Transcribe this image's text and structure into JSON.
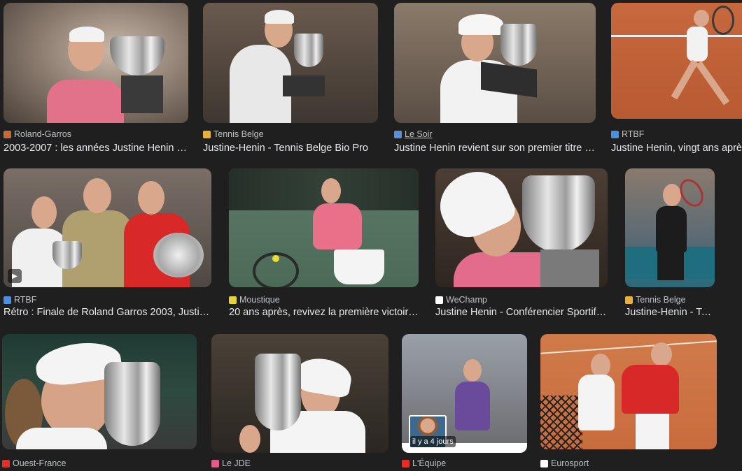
{
  "results": [
    {
      "source": "Roland-Garros",
      "title": "2003-2007 : les années Justine Henin - ...",
      "favicon_color": "#c8693a",
      "image_alt": "Justine Henin holding the Roland-Garros trophy"
    },
    {
      "source": "Tennis Belge",
      "title": "Justine-Henin - Tennis Belge Bio Pro",
      "favicon_color": "#e8b23a",
      "image_alt": "Justine Henin in white jacket with trophy"
    },
    {
      "source": "Le Soir",
      "title": "Justine Henin revient sur son premier titre à...",
      "favicon_color": "#5a8fd8",
      "image_alt": "Justine Henin kissing trophy"
    },
    {
      "source": "RTBF",
      "title": "Justine Henin, vingt ans après",
      "favicon_color": "#4a90e2",
      "image_alt": "Justine Henin playing on clay court"
    },
    {
      "source": "RTBF",
      "title": "Rétro : Finale de Roland Garros 2003, Justin...",
      "favicon_color": "#4a90e2",
      "image_alt": "Roland Garros 2003 final trophy ceremony",
      "video": true,
      "play_glyph": "▶"
    },
    {
      "source": "Moustique",
      "title": "20 ans après, revivez la première victoire ...",
      "favicon_color": "#e8d23a",
      "image_alt": "Justine Henin hitting a forehand"
    },
    {
      "source": "WeChamp",
      "title": "Justine Henin - Conférencier Sportif- ...",
      "favicon_color": "#ffffff",
      "image_alt": "Justine Henin kissing the Coupe Suzanne Lenglen"
    },
    {
      "source": "Tennis Belge",
      "title": "Justine-Henin - Tennis...",
      "favicon_color": "#e8b23a",
      "image_alt": "Justine Henin celebrating with racquet"
    },
    {
      "source": "Ouest-France",
      "title": "",
      "favicon_color": "#e0302a",
      "image_alt": "Justine Henin kissing trophy close-up"
    },
    {
      "source": "Le JDE",
      "title": "",
      "favicon_color": "#e05a8a",
      "image_alt": "Justine Henin lifting trophy"
    },
    {
      "source": "L'Équipe",
      "title": "",
      "favicon_color": "#e0302a",
      "image_alt": "Justine Henin celebrating on court",
      "badge": "il y a 4 jours"
    },
    {
      "source": "Eurosport",
      "title": "",
      "favicon_color": "#ffffff",
      "image_alt": "Justine Henin with opponent at net"
    }
  ]
}
